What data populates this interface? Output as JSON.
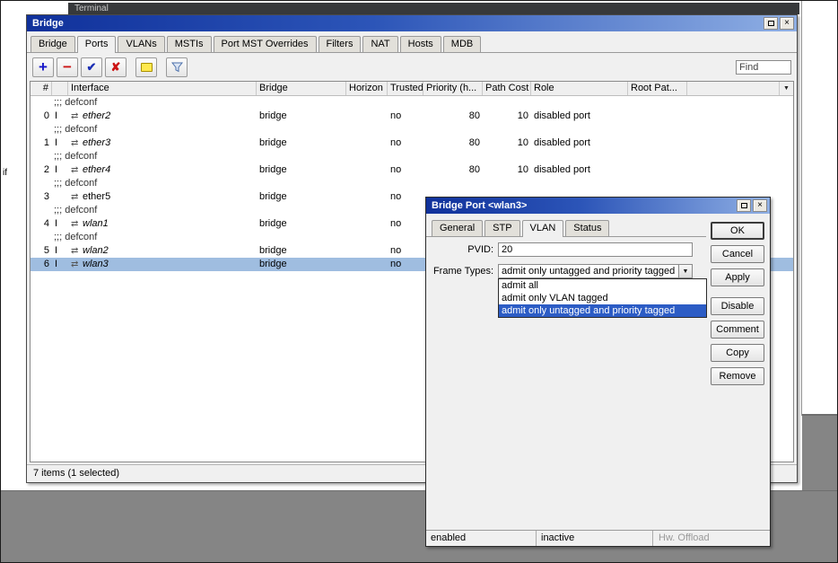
{
  "desktop": {
    "background_window_title": "Terminal",
    "left_text_fragment": "if"
  },
  "colors": {
    "titlebar_blue": "#10319b",
    "row_selection": "#9fbde0",
    "dropdown_selection": "#2c5cc5",
    "desktop_gray": "#858585"
  },
  "bridge_window": {
    "title": "Bridge",
    "tabs": [
      "Bridge",
      "Ports",
      "VLANs",
      "MSTIs",
      "Port MST Overrides",
      "Filters",
      "NAT",
      "Hosts",
      "MDB"
    ],
    "active_tab": "Ports",
    "find_label": "Find",
    "columns": [
      "#",
      "",
      "Interface",
      "Bridge",
      "Horizon",
      "Trusted",
      "Priority (h...",
      "Path Cost",
      "Role",
      "Root Pat..."
    ],
    "rows": [
      {
        "type": "comment",
        "text": ";;; defconf"
      },
      {
        "type": "port",
        "num": "0",
        "flags": "I",
        "interface": "ether2",
        "bridge": "bridge",
        "horizon": "",
        "trusted": "no",
        "priority": "80",
        "path_cost": "10",
        "role": "disabled port",
        "root_path": ""
      },
      {
        "type": "comment",
        "text": ";;; defconf"
      },
      {
        "type": "port",
        "num": "1",
        "flags": "I",
        "interface": "ether3",
        "bridge": "bridge",
        "horizon": "",
        "trusted": "no",
        "priority": "80",
        "path_cost": "10",
        "role": "disabled port",
        "root_path": ""
      },
      {
        "type": "comment",
        "text": ";;; defconf"
      },
      {
        "type": "port",
        "num": "2",
        "flags": "I",
        "interface": "ether4",
        "bridge": "bridge",
        "horizon": "",
        "trusted": "no",
        "priority": "80",
        "path_cost": "10",
        "role": "disabled port",
        "root_path": ""
      },
      {
        "type": "comment",
        "text": ";;; defconf"
      },
      {
        "type": "port",
        "num": "3",
        "flags": "",
        "interface": "ether5",
        "bridge": "bridge",
        "horizon": "",
        "trusted": "no",
        "priority": "",
        "path_cost": "",
        "role": "",
        "root_path": ""
      },
      {
        "type": "comment",
        "text": ";;; defconf"
      },
      {
        "type": "port",
        "num": "4",
        "flags": "I",
        "interface": "wlan1",
        "bridge": "bridge",
        "horizon": "",
        "trusted": "no",
        "priority": "",
        "path_cost": "",
        "role": "",
        "root_path": ""
      },
      {
        "type": "comment",
        "text": ";;; defconf"
      },
      {
        "type": "port",
        "num": "5",
        "flags": "I",
        "interface": "wlan2",
        "bridge": "bridge",
        "horizon": "",
        "trusted": "no",
        "priority": "",
        "path_cost": "",
        "role": "",
        "root_path": ""
      },
      {
        "type": "port",
        "num": "6",
        "flags": "I",
        "interface": "wlan3",
        "bridge": "bridge",
        "horizon": "",
        "trusted": "no",
        "priority": "",
        "path_cost": "",
        "role": "",
        "root_path": "",
        "selected": true
      }
    ],
    "status": "7 items (1 selected)"
  },
  "dialog": {
    "title": "Bridge Port <wlan3>",
    "tabs": [
      "General",
      "STP",
      "VLAN",
      "Status"
    ],
    "active_tab": "VLAN",
    "pvid_label": "PVID:",
    "pvid_value": "20",
    "frame_types_label": "Frame Types:",
    "frame_types_value": "admit only untagged and priority tagged",
    "frame_types_options": [
      "admit all",
      "admit only VLAN tagged",
      "admit only untagged and priority tagged"
    ],
    "selected_option": "admit only untagged and priority tagged",
    "buttons": [
      "OK",
      "Cancel",
      "Apply",
      "Disable",
      "Comment",
      "Copy",
      "Remove"
    ],
    "status_segments": [
      "enabled",
      "inactive",
      "Hw. Offload"
    ]
  }
}
